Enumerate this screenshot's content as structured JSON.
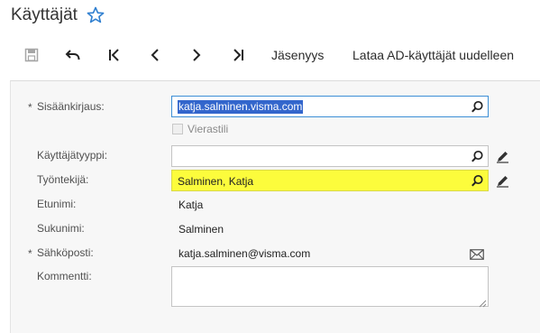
{
  "header": {
    "title": "Käyttäjät"
  },
  "toolbar": {
    "membership_label": "Jäsenyys",
    "reload_ad_label": "Lataa AD-käyttäjät uudelleen"
  },
  "form": {
    "required_marker": "*",
    "login": {
      "label": "Sisäänkirjaus:",
      "value": "katja.salminen.visma.com"
    },
    "guest_account": {
      "label": "Vierastili"
    },
    "user_type": {
      "label": "Käyttäjätyyppi:",
      "value": ""
    },
    "employee": {
      "label": "Työntekijä:",
      "value": "Salminen, Katja"
    },
    "first_name": {
      "label": "Etunimi:",
      "value": "Katja"
    },
    "last_name": {
      "label": "Sukunimi:",
      "value": "Salminen"
    },
    "email": {
      "label": "Sähköposti:",
      "value": "katja.salminen@visma.com"
    },
    "comment": {
      "label": "Kommentti:",
      "value": ""
    }
  },
  "colors": {
    "accent": "#3d8fd6",
    "highlight": "#fcfc3c",
    "selection": "#3366cc"
  },
  "icons": [
    "star-icon",
    "save-icon",
    "undo-icon",
    "first-record-icon",
    "previous-icon",
    "next-icon",
    "last-record-icon",
    "search-icon",
    "pencil-icon",
    "envelope-icon"
  ]
}
